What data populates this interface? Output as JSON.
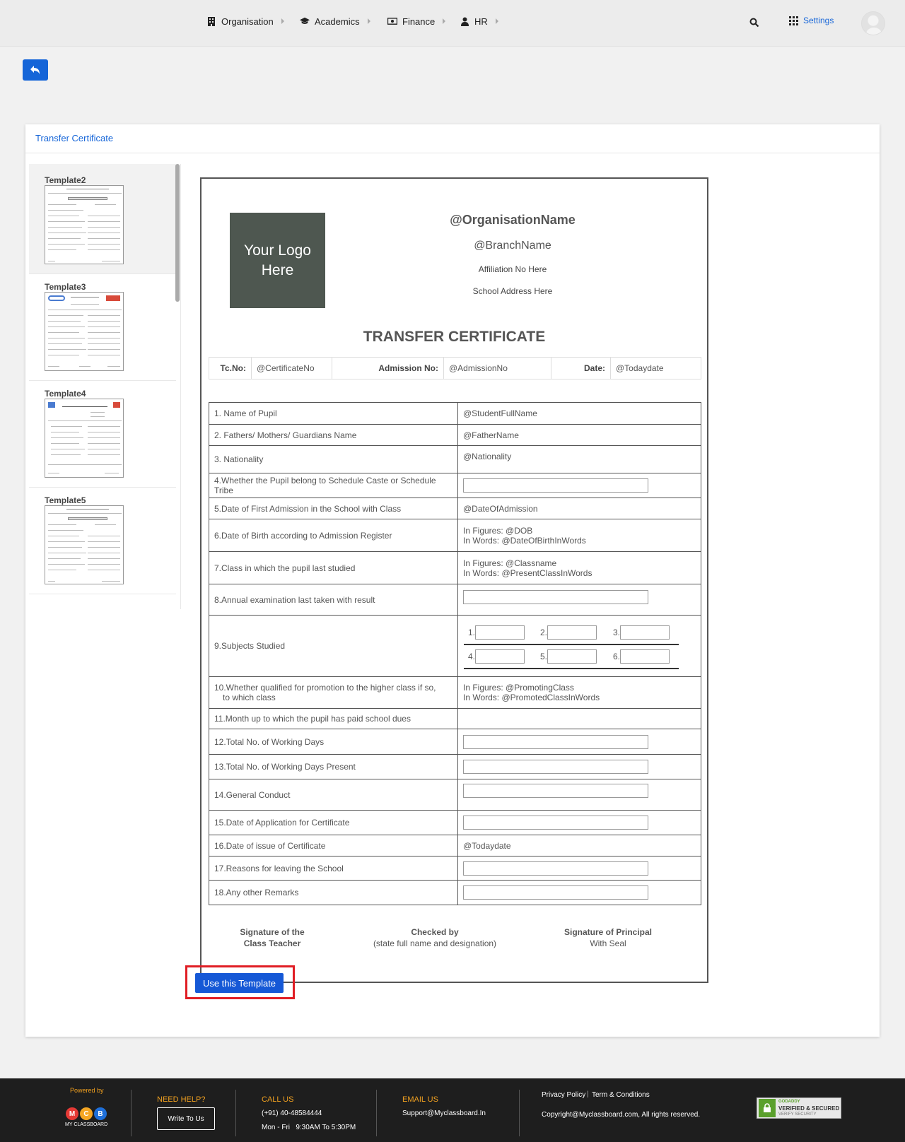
{
  "nav": {
    "items": [
      {
        "label": "Organisation"
      },
      {
        "label": "Academics"
      },
      {
        "label": "Finance"
      },
      {
        "label": "HR"
      }
    ],
    "settings_label": "Settings"
  },
  "card": {
    "title": "Transfer Certificate"
  },
  "templates": [
    {
      "name": "Template2",
      "selected": true
    },
    {
      "name": "Template3",
      "selected": false
    },
    {
      "name": "Template4",
      "selected": false
    },
    {
      "name": "Template5",
      "selected": false
    }
  ],
  "certificate": {
    "logo_text": "Your Logo Here",
    "org_name": "@OrganisationName",
    "branch_name": "@BranchName",
    "affiliation": "Affiliation No Here",
    "address": "School Address Here",
    "heading": "TRANSFER CERTIFICATE",
    "meta": {
      "tc_label": "Tc.No:",
      "tc_value": "@CertificateNo",
      "admission_label": "Admission No:",
      "admission_value": "@AdmissionNo",
      "date_label": "Date:",
      "date_value": "@Todaydate"
    },
    "rows": [
      {
        "q": "1. Name of Pupil",
        "a1": "@StudentFullName"
      },
      {
        "q": "2. Fathers/ Mothers/ Guardians Name",
        "a1": "@FatherName"
      },
      {
        "q": "3. Nationality",
        "a1": "@Nationality"
      },
      {
        "q": "4.Whether the Pupil belong to Schedule Caste or Schedule Tribe"
      },
      {
        "q": "5.Date of First Admission in the School with Class",
        "a1": "@DateOfAdmission"
      },
      {
        "q": "6.Date of Birth according to Admission Register",
        "a1": "In Figures: @DOB",
        "a2": "In Words: @DateOfBirthInWords"
      },
      {
        "q": "7.Class in which the pupil last studied",
        "a1": "In Figures:  @Classname",
        "a2": "In Words:  @PresentClassInWords"
      },
      {
        "q": "8.Annual examination last taken with result"
      },
      {
        "q": "9.Subjects Studied",
        "subjects": [
          "1.",
          "2.",
          "3.",
          "4.",
          "5.",
          "6."
        ]
      },
      {
        "q": "10.Whether qualified for promotion to the higher class if so,",
        "q2": "to which class",
        "a1": "In Figures:  @PromotingClass",
        "a2": "In Words:  @PromotedClassInWords"
      },
      {
        "q": "11.Month up to which the pupil has paid school dues"
      },
      {
        "q": "12.Total No. of Working Days"
      },
      {
        "q": "13.Total No. of Working Days Present"
      },
      {
        "q": "14.General Conduct"
      },
      {
        "q": "15.Date of Application for Certificate"
      },
      {
        "q": "16.Date of issue of Certificate",
        "a1": "@Todaydate"
      },
      {
        "q": "17.Reasons for leaving the School"
      },
      {
        "q": "18.Any other Remarks"
      }
    ],
    "signatures": {
      "teacher_1": "Signature of the",
      "teacher_2": "Class Teacher",
      "checked_1": "Checked by",
      "checked_2": "(state full name and designation)",
      "principal_1": "Signature of Principal",
      "principal_2": "With Seal"
    }
  },
  "use_template_label": "Use this Template",
  "footer": {
    "powered_by": "Powered by",
    "brand": "MY CLASSBOARD",
    "need_help": "NEED HELP?",
    "write_to_us": "Write To Us",
    "call_us": "CALL US",
    "phone": "(+91) 40-48584444",
    "hours": "Mon - Fri   9:30AM To 5:30PM",
    "email_us": "EMAIL US",
    "email": "Support@Myclassboard.In",
    "privacy": "Privacy Policy",
    "terms": "Term & Conditions",
    "copyright": "Copyright@Myclassboard.com, All rights reserved.",
    "badge_1": "GODADDY",
    "badge_2": "VERIFIED & SECURED",
    "badge_3": "VERIFY SECURITY"
  },
  "colors": {
    "accent": "#1565d8",
    "highlight_frame": "#e01d24",
    "footer_bg": "#1e1e1e",
    "footer_heading": "#f0a020"
  }
}
